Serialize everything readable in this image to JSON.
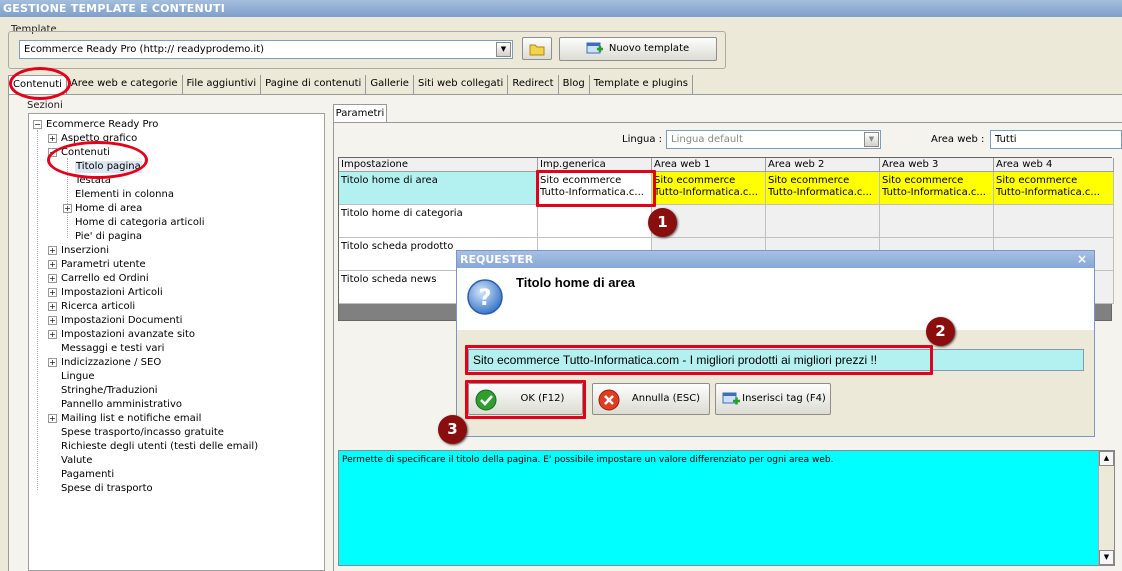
{
  "window": {
    "title": "GESTIONE TEMPLATE E CONTENUTI"
  },
  "template": {
    "group_label": "Template",
    "selected": "Ecommerce Ready Pro (http://        readyprodemo.it)",
    "new_button": "Nuovo template"
  },
  "tabs": [
    "Contenuti",
    "Aree web e categorie",
    "File aggiuntivi",
    "Pagine di contenuti",
    "Gallerie",
    "Siti web collegati",
    "Redirect",
    "Blog",
    "Template e plugins"
  ],
  "sections": {
    "label": "Sezioni",
    "tree": [
      {
        "label": "Ecommerce Ready Pro",
        "level": 0,
        "expander": "−"
      },
      {
        "label": "Aspetto grafico",
        "level": 1,
        "expander": "+"
      },
      {
        "label": "Contenuti",
        "level": 1,
        "expander": "−"
      },
      {
        "label": "Titolo pagina",
        "level": 2,
        "expander": ""
      },
      {
        "label": "Testata",
        "level": 2,
        "expander": ""
      },
      {
        "label": "Elementi in colonna",
        "level": 2,
        "expander": ""
      },
      {
        "label": "Home di area",
        "level": 2,
        "expander": "+"
      },
      {
        "label": "Home di categoria articoli",
        "level": 2,
        "expander": ""
      },
      {
        "label": "Pie' di pagina",
        "level": 2,
        "expander": ""
      },
      {
        "label": "Inserzioni",
        "level": 1,
        "expander": "+"
      },
      {
        "label": "Parametri utente",
        "level": 1,
        "expander": "+"
      },
      {
        "label": "Carrello ed Ordini",
        "level": 1,
        "expander": "+"
      },
      {
        "label": "Impostazioni Articoli",
        "level": 1,
        "expander": "+"
      },
      {
        "label": "Ricerca articoli",
        "level": 1,
        "expander": "+"
      },
      {
        "label": "Impostazioni Documenti",
        "level": 1,
        "expander": "+"
      },
      {
        "label": "Impostazioni avanzate sito",
        "level": 1,
        "expander": "+"
      },
      {
        "label": "Messaggi e testi vari",
        "level": 1,
        "expander": ""
      },
      {
        "label": "Indicizzazione / SEO",
        "level": 1,
        "expander": "+"
      },
      {
        "label": "Lingue",
        "level": 1,
        "expander": ""
      },
      {
        "label": "Stringhe/Traduzioni",
        "level": 1,
        "expander": ""
      },
      {
        "label": "Pannello amministrativo",
        "level": 1,
        "expander": ""
      },
      {
        "label": "Mailing list e notifiche email",
        "level": 1,
        "expander": "+"
      },
      {
        "label": "Spese trasporto/incasso gratuite",
        "level": 1,
        "expander": ""
      },
      {
        "label": "Richieste degli utenti (testi delle email)",
        "level": 1,
        "expander": ""
      },
      {
        "label": "Valute",
        "level": 1,
        "expander": ""
      },
      {
        "label": "Pagamenti",
        "level": 1,
        "expander": ""
      },
      {
        "label": "Spese di trasporto",
        "level": 1,
        "expander": ""
      }
    ]
  },
  "params": {
    "tab": "Parametri",
    "lingua_label": "Lingua :",
    "lingua_value": "Lingua default",
    "area_label": "Area web :",
    "area_value": "Tutti",
    "columns": [
      "Impostazione",
      "Imp.generica",
      "Area web 1",
      "Area web 2",
      "Area web 3",
      "Area web 4"
    ],
    "rows": [
      {
        "name": "Titolo home di area",
        "values": [
          "Sito ecommerce\nTutto-Informatica.c...",
          "Sito ecommerce\nTutto-Informatica.c...",
          "Sito ecommerce\nTutto-Informatica.c...",
          "Sito ecommerce\nTutto-Informatica.c...",
          "Sito ecommerce\nTutto-Informatica.c..."
        ]
      },
      {
        "name": "Titolo home di categoria",
        "values": [
          "",
          "",
          "",
          "",
          ""
        ]
      },
      {
        "name": "Titolo scheda prodotto",
        "values": [
          "",
          "",
          "",
          "",
          ""
        ]
      },
      {
        "name": "Titolo scheda news",
        "values": [
          "",
          "",
          "",
          "",
          ""
        ]
      }
    ],
    "description": "Permette di specificare il titolo della pagina. E' possibile impostare un valore differenziato per ogni area web."
  },
  "dialog": {
    "title": "REQUESTER",
    "heading": "Titolo home di area",
    "value": "Sito ecommerce Tutto-Informatica.com - I migliori prodotti ai migliori prezzi !!",
    "ok": "OK (F12)",
    "cancel": "Annulla (ESC)",
    "insert_tag": "Inserisci tag (F4)",
    "close": "×"
  },
  "callouts": [
    "1",
    "2",
    "3"
  ],
  "colors": {
    "highlight_cell": "#ffff00",
    "selected_row": "#b3f0f0",
    "description_bg": "#00ffff",
    "callout": "#8b0e0e",
    "annotation": "#e2001a"
  }
}
